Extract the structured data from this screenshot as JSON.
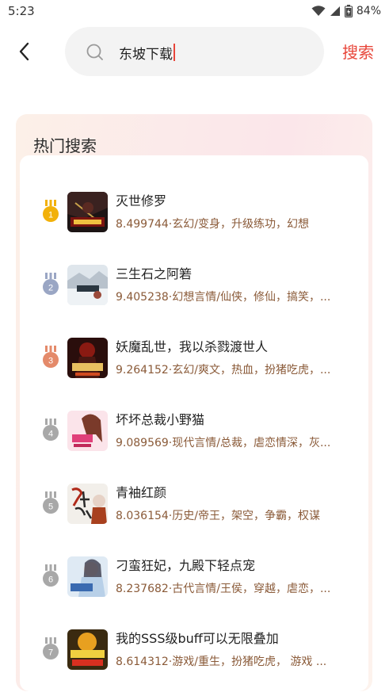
{
  "status_bar": {
    "time": "5:23",
    "battery": "84%",
    "icons": [
      "wifi-icon",
      "signal-icon",
      "battery-icon"
    ]
  },
  "header": {
    "back_icon": "chevron-left-icon",
    "search_icon": "search-icon",
    "search_value": "东坡下载",
    "search_button": "搜索"
  },
  "colors": {
    "accent": "#e8463a",
    "meta_text": "#8a5a38",
    "gold": "#f2b10a",
    "silver": "#9aa6c4",
    "bronze": "#e48a6a",
    "gray": "#a8a8a8"
  },
  "hot_search": {
    "title": "热门搜索",
    "items": [
      {
        "rank": "1",
        "badge": "gold",
        "title": "灭世修罗",
        "meta": "8.499744·玄幻/变身，升级练功，幻想"
      },
      {
        "rank": "2",
        "badge": "silver",
        "title": "三生石之阿箬",
        "meta": "9.405238·幻想言情/仙侠，修仙，搞笑，..."
      },
      {
        "rank": "3",
        "badge": "bronze",
        "title": "妖魔乱世，我以杀戮渡世人",
        "meta": "9.264152·玄幻/爽文，热血，扮猪吃虎，..."
      },
      {
        "rank": "4",
        "badge": "gray",
        "title": "坏坏总裁小野猫",
        "meta": "9.089569·现代言情/总裁，虐恋情深，灰..."
      },
      {
        "rank": "5",
        "badge": "gray",
        "title": "青袖红颜",
        "meta": "8.036154·历史/帝王，架空，争霸，权谋"
      },
      {
        "rank": "6",
        "badge": "gray",
        "title": "刁蛮狂妃，九殿下轻点宠",
        "meta": "8.237682·古代言情/王侯，穿越，虐恋，..."
      },
      {
        "rank": "7",
        "badge": "gray",
        "title": "我的SSS级buff可以无限叠加",
        "meta": "8.614312·游戏/重生，扮猪吃虎， 游戏 ..."
      }
    ]
  }
}
